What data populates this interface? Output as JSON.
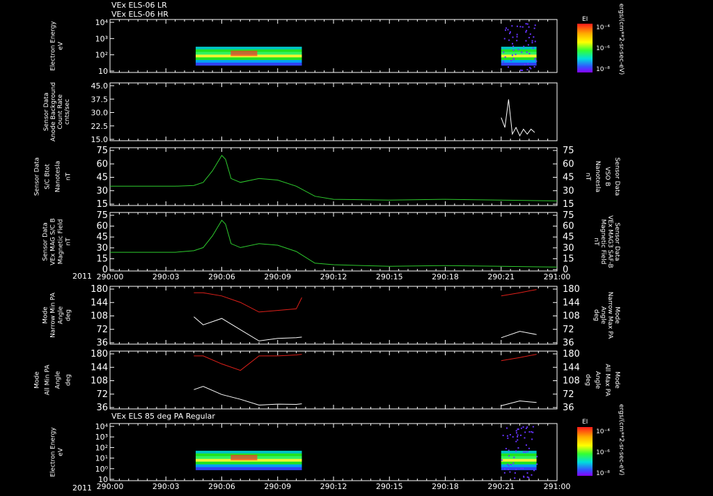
{
  "header": {
    "line1": "VEx ELS-06 LR",
    "line2": "VEx ELS-06 HR",
    "bottom_title": "VEx ELS 85 deg PA Regular"
  },
  "x_axis": {
    "year": "2011",
    "ticks": [
      "290:00",
      "290:03",
      "290:06",
      "290:09",
      "290:12",
      "290:15",
      "290:18",
      "290:21",
      "291:00"
    ]
  },
  "colorbar": {
    "label": "EI",
    "ticks": [
      "10⁻⁴",
      "10⁻⁶",
      "10⁻⁸"
    ],
    "units": "ergs/(cm**2-sr-sec-eV)"
  },
  "panels": {
    "p1": {
      "ylabel": [
        "Electron Energy",
        "eV"
      ],
      "ticks": [
        "10⁴",
        "10³",
        "10²",
        "10"
      ]
    },
    "p2": {
      "ylabel": [
        "Sensor Data",
        "Anode Background",
        "Count Rate",
        "cnts/sec"
      ],
      "ticks": [
        "45.0",
        "37.5",
        "30.0",
        "22.5",
        "15.0"
      ]
    },
    "p3": {
      "ylabel": [
        "Sensor Data",
        "S/C Btot",
        "Nanotesla",
        "nT"
      ],
      "ticks": [
        "75",
        "60",
        "45",
        "30",
        "15"
      ],
      "right_label": [
        "Sensor Data",
        "VSO B",
        "Nanotesla",
        "nT"
      ]
    },
    "p4": {
      "ylabel": [
        "Sensor Data",
        "VEx MAG S/C B",
        "Magnetic Field",
        "nT"
      ],
      "ticks": [
        "75",
        "60",
        "45",
        "30",
        "15",
        "0"
      ],
      "right_label": [
        "Sensor Data",
        "VEx MAG3 SAF-B",
        "Magnetic Field",
        "nT"
      ]
    },
    "p5": {
      "ylabel": [
        "Mode",
        "Narrow Min PA",
        "Angle",
        "deg"
      ],
      "ticks": [
        "180",
        "144",
        "108",
        "72",
        "36"
      ],
      "right_label": [
        "Mode",
        "Narrow Max PA",
        "Angle",
        "deg"
      ]
    },
    "p6": {
      "ylabel": [
        "Mode",
        "All Min PA",
        "Angle",
        "deg"
      ],
      "ticks": [
        "180",
        "144",
        "108",
        "72",
        "36"
      ],
      "right_label": [
        "Mode",
        "All Max PA",
        "Angle",
        "deg"
      ]
    },
    "p7": {
      "ylabel": [
        "Electron Energy",
        "eV"
      ],
      "ticks": [
        "10⁴",
        "10³",
        "10²",
        "10¹",
        "10⁰",
        "10"
      ]
    }
  },
  "colors": {
    "background": "#000000",
    "axes": "#ffffff",
    "mag": "#2ecc2e",
    "pa_max": "#e0201a",
    "pa_min": "#ffffff",
    "right_green": "#22dd22",
    "right_red": "#dd1a1a"
  },
  "chart_data": [
    {
      "type": "heatmap",
      "ylabel": "Electron Energy eV",
      "ylim_log10": [
        0.5,
        4.2
      ],
      "segments_time": [
        [
          "290:04.6",
          "290:10.3"
        ],
        [
          "290:21.0",
          "290:22.9"
        ]
      ],
      "energy_band_log10": [
        1.0,
        2.3
      ]
    },
    {
      "type": "line",
      "ylabel": "Sensor Data Anode Background Count Rate cnts/sec",
      "ylim": [
        10,
        45
      ],
      "x": [
        "290:21.0",
        "290:21.2",
        "290:21.4",
        "290:21.6",
        "290:21.8",
        "290:22.0",
        "290:22.2",
        "290:22.4",
        "290:22.6",
        "290:22.8"
      ],
      "values": [
        24,
        18,
        35,
        14,
        18,
        13,
        17,
        14,
        17,
        15
      ]
    },
    {
      "type": "line",
      "ylabel": "Sensor Data S/C Btot Nanotesla nT",
      "ylim": [
        0,
        75
      ],
      "x": [
        "290:00",
        "290:02",
        "290:03.5",
        "290:04.5",
        "290:05.0",
        "290:05.5",
        "290:06.0",
        "290:06.2",
        "290:06.5",
        "290:07",
        "290:08",
        "290:09",
        "290:10",
        "290:11",
        "290:12",
        "290:15",
        "290:18",
        "290:21",
        "290:24"
      ],
      "values": [
        25,
        25,
        25,
        26,
        30,
        45,
        65,
        60,
        35,
        30,
        35,
        33,
        25,
        12,
        8,
        7,
        8,
        7,
        6
      ]
    },
    {
      "type": "line",
      "ylabel": "Sensor Data VEx MAG S/C B Magnetic Field nT",
      "ylim": [
        0,
        75
      ],
      "x": [
        "290:00",
        "290:02",
        "290:03.5",
        "290:04.5",
        "290:05.0",
        "290:05.5",
        "290:06.0",
        "290:06.2",
        "290:06.5",
        "290:07",
        "290:08",
        "290:09",
        "290:10",
        "290:11",
        "290:12",
        "290:15",
        "290:18",
        "290:21",
        "290:24"
      ],
      "values": [
        24,
        24,
        24,
        26,
        30,
        45,
        65,
        60,
        35,
        30,
        35,
        33,
        25,
        10,
        8,
        6,
        7,
        6,
        5
      ]
    },
    {
      "type": "line",
      "ylabel": "Mode Narrow Min PA Angle deg",
      "ylim": [
        0,
        180
      ],
      "series": [
        {
          "x": [
            "290:04.5",
            "290:05",
            "290:06",
            "290:07",
            "290:08",
            "290:09",
            "290:10",
            "290:10.3",
            "290:21",
            "290:22",
            "290:22.9"
          ],
          "values": [
            160,
            160,
            150,
            130,
            100,
            105,
            110,
            145,
            150,
            160,
            170
          ]
        },
        {
          "x": [
            "290:04.5",
            "290:05",
            "290:06",
            "290:07",
            "290:08",
            "290:09",
            "290:10",
            "290:10.3",
            "290:21",
            "290:22",
            "290:22.9"
          ],
          "values": [
            85,
            60,
            80,
            45,
            10,
            18,
            20,
            22,
            20,
            40,
            30
          ]
        }
      ]
    },
    {
      "type": "line",
      "ylabel": "Mode All Min PA Angle deg",
      "ylim": [
        0,
        180
      ],
      "series": [
        {
          "x": [
            "290:04.5",
            "290:05",
            "290:06",
            "290:07",
            "290:08",
            "290:09",
            "290:10",
            "290:10.3",
            "290:21",
            "290:22",
            "290:22.9"
          ],
          "values": [
            165,
            165,
            140,
            120,
            165,
            165,
            168,
            170,
            150,
            160,
            170
          ]
        },
        {
          "x": [
            "290:04.5",
            "290:05",
            "290:06",
            "290:07",
            "290:08",
            "290:09",
            "290:10",
            "290:10.3",
            "290:21",
            "290:22",
            "290:22.9"
          ],
          "values": [
            60,
            70,
            45,
            30,
            12,
            15,
            14,
            16,
            10,
            25,
            20
          ]
        }
      ]
    },
    {
      "type": "heatmap",
      "ylabel": "Electron Energy eV",
      "ylim_log10": [
        0,
        4.2
      ],
      "segments_time": [
        [
          "290:04.6",
          "290:10.3"
        ],
        [
          "290:21.0",
          "290:22.9"
        ]
      ],
      "energy_band_log10": [
        0.8,
        2.2
      ]
    }
  ]
}
